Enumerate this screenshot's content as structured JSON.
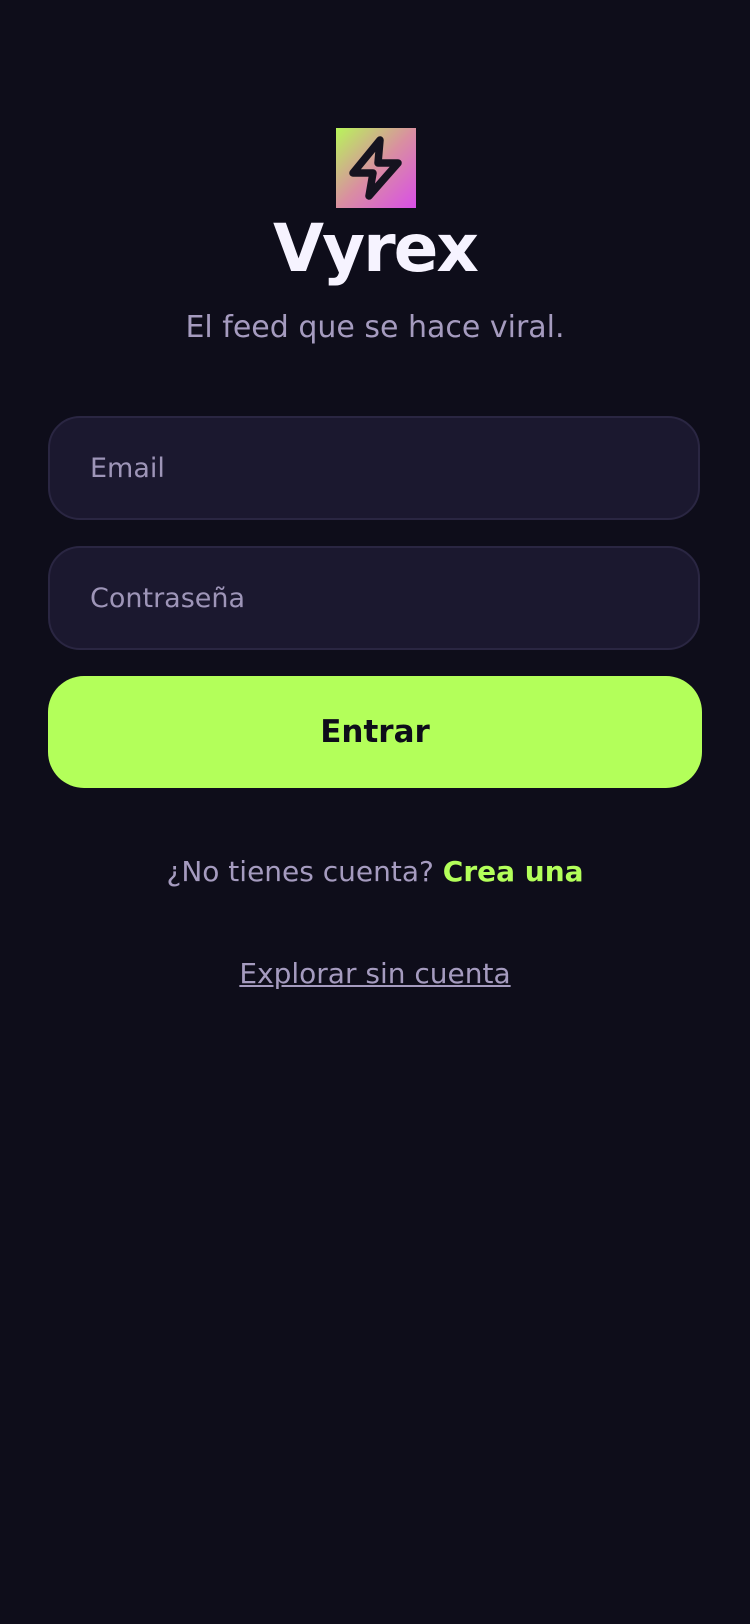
{
  "app": {
    "name": "Vyrex",
    "tagline": "El feed que se hace viral.",
    "logo_icon": "lightning-bolt-icon"
  },
  "form": {
    "email_placeholder": "Email",
    "email_value": "",
    "password_placeholder": "Contraseña",
    "password_value": "",
    "submit_label": "Entrar"
  },
  "signup": {
    "prompt": "¿No tienes cuenta?",
    "link_label": "Crea una"
  },
  "explore": {
    "link_label": "Explorar sin cuenta"
  },
  "colors": {
    "background": "#0e0d1a",
    "accent": "#b3ff5a",
    "field_background": "#1b182f",
    "muted_text": "#a59bbf",
    "logo_gradient_start": "#b8f55a",
    "logo_gradient_end": "#d94ee8"
  }
}
